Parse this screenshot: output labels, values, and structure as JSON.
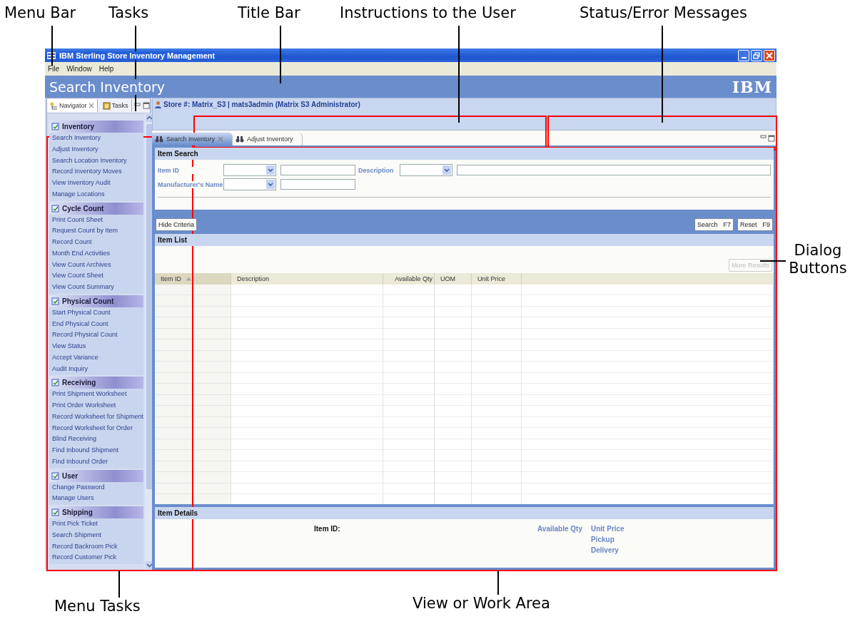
{
  "window": {
    "title": "IBM Sterling Store Inventory Management",
    "menu": [
      "File",
      "Window",
      "Help"
    ]
  },
  "banner": {
    "title": "Search Inventory",
    "logo": "IBM"
  },
  "navigator": {
    "tabs": [
      {
        "label": "Navigator",
        "selected": true
      },
      {
        "label": "Tasks",
        "selected": false
      }
    ],
    "groups": [
      {
        "title": "Inventory",
        "items": [
          "Search Inventory",
          "Adjust Inventory",
          "Search Location Inventory",
          "Record Inventory Moves",
          "View Inventory Audit",
          "Manage Locations"
        ]
      },
      {
        "title": "Cycle Count",
        "items": [
          "Print Count Sheet",
          "Request Count by Item",
          "Record Count",
          "Month End Activities",
          "View Count Archives",
          "View Count Sheet",
          "View Count Summary"
        ]
      },
      {
        "title": "Physical Count",
        "items": [
          "Start Physical Count",
          "End Physical Count",
          "Record Physical Count",
          "View Status",
          "Accept Variance",
          "Audit Inquiry"
        ]
      },
      {
        "title": "Receiving",
        "items": [
          "Print Shipment Worksheet",
          "Print Order Worksheet",
          "Record Worksheet for Shipment",
          "Record Worksheet for Order",
          "Blind Receiving",
          "Find Inbound Shipment",
          "Find Inbound Order"
        ]
      },
      {
        "title": "User",
        "items": [
          "Change Password",
          "Manage Users"
        ]
      },
      {
        "title": "Shipping",
        "items": [
          "Print Pick Ticket",
          "Search Shipment",
          "Record Backroom Pick",
          "Record Customer Pick"
        ]
      }
    ]
  },
  "store_info": "Store #: Matrix_S3 | mats3admin (Matrix S3 Administrator)",
  "editor_tabs": [
    {
      "label": "Search Inventory",
      "selected": true
    },
    {
      "label": "Adjust Inventory",
      "selected": false
    }
  ],
  "item_search": {
    "title": "Item Search",
    "fields": [
      {
        "label": "Item ID"
      },
      {
        "label": "Description"
      },
      {
        "label": "Manufacturer's Name"
      }
    ]
  },
  "criteria_bar": {
    "hide": "Hide Criteria",
    "search": {
      "label": "Search",
      "key": "F7"
    },
    "reset": {
      "label": "Reset",
      "key": "F9"
    }
  },
  "item_list": {
    "title": "Item List",
    "more_button": {
      "label": "More Results",
      "disabled": true
    },
    "columns": [
      {
        "label": "Item ID",
        "sorted": true
      },
      {
        "label": "Description",
        "sorted": false
      },
      {
        "label": "Available Qty",
        "sorted": false
      },
      {
        "label": "UOM",
        "sorted": false
      },
      {
        "label": "Unit Price",
        "sorted": false
      }
    ]
  },
  "item_details": {
    "title": "Item Details",
    "item_label": "Item ID:",
    "qty_label": "Available Qty",
    "price_labels": [
      "Unit Price",
      "Pickup",
      "Delivery"
    ]
  },
  "annotations": [
    {
      "text": "Menu Bar"
    },
    {
      "text": "Tasks"
    },
    {
      "text": "Title Bar"
    },
    {
      "text": "Instructions to the User"
    },
    {
      "text": "Status/Error Messages"
    },
    {
      "text": "Dialog Buttons"
    },
    {
      "text": "Menu Tasks"
    },
    {
      "text": "View or Work Area"
    }
  ]
}
